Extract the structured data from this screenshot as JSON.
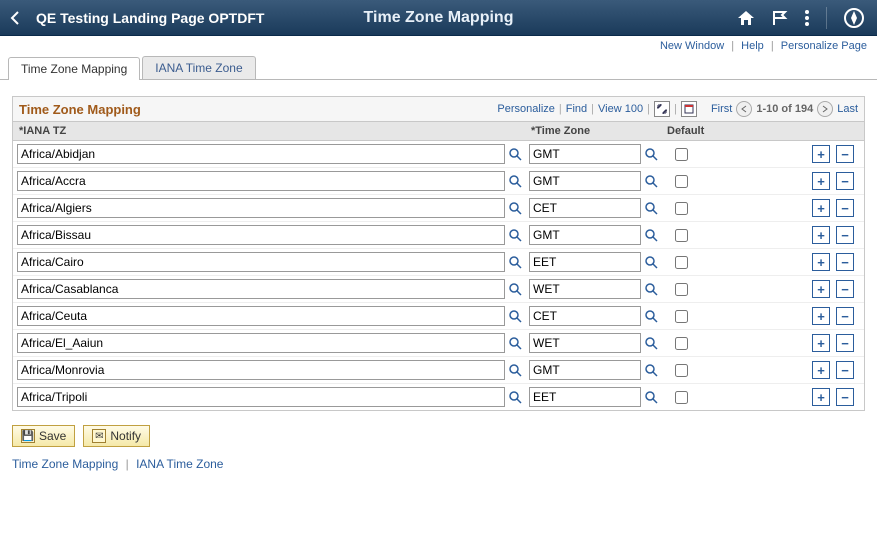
{
  "banner": {
    "back_target": "QE Testing Landing Page OPTDFT",
    "page_title": "Time Zone Mapping"
  },
  "util_links": {
    "new_window": "New Window",
    "help": "Help",
    "personalize": "Personalize Page"
  },
  "tabs": {
    "active": "Time Zone Mapping",
    "inactive": "IANA Time Zone"
  },
  "grid": {
    "title": "Time Zone Mapping",
    "actions": {
      "personalize": "Personalize",
      "find": "Find",
      "view_all": "View 100",
      "first": "First",
      "range": "1-10 of 194",
      "last": "Last"
    },
    "columns": {
      "iana": "*IANA TZ",
      "tz": "*Time Zone",
      "def": "Default"
    },
    "rows": [
      {
        "iana": "Africa/Abidjan",
        "tz": "GMT",
        "def": false
      },
      {
        "iana": "Africa/Accra",
        "tz": "GMT",
        "def": false
      },
      {
        "iana": "Africa/Algiers",
        "tz": "CET",
        "def": false
      },
      {
        "iana": "Africa/Bissau",
        "tz": "GMT",
        "def": false
      },
      {
        "iana": "Africa/Cairo",
        "tz": "EET",
        "def": false
      },
      {
        "iana": "Africa/Casablanca",
        "tz": "WET",
        "def": false
      },
      {
        "iana": "Africa/Ceuta",
        "tz": "CET",
        "def": false
      },
      {
        "iana": "Africa/El_Aaiun",
        "tz": "WET",
        "def": false
      },
      {
        "iana": "Africa/Monrovia",
        "tz": "GMT",
        "def": false
      },
      {
        "iana": "Africa/Tripoli",
        "tz": "EET",
        "def": false
      }
    ]
  },
  "footer": {
    "save": "Save",
    "notify": "Notify",
    "link1": "Time Zone Mapping",
    "link2": "IANA Time Zone"
  }
}
